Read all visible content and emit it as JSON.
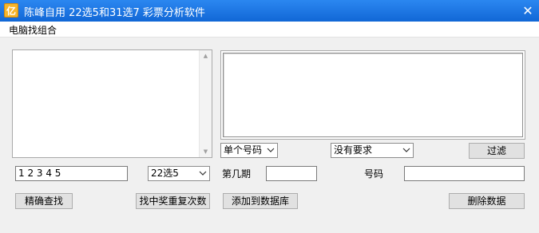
{
  "window": {
    "app_icon_text": "亿",
    "title": "陈峰自用 22选5和31选7 彩票分析软件",
    "close_glyph": "✕"
  },
  "menu": {
    "items": [
      "电脑找组合"
    ]
  },
  "left_input": {
    "value": "1 2 3 4 5"
  },
  "lottery_select": {
    "selected": "22选5"
  },
  "number_type_select": {
    "selected": "单个号码"
  },
  "requirement_select": {
    "selected": "没有要求"
  },
  "buttons": {
    "filter": "过滤",
    "exact_search": "精确查找",
    "find_repeat_count": "找中奖重复次数",
    "add_to_database": "添加到数据库",
    "delete_data": "删除数据"
  },
  "labels": {
    "period": "第几期",
    "number": "号码"
  },
  "fields": {
    "period_value": "",
    "number_value": ""
  }
}
